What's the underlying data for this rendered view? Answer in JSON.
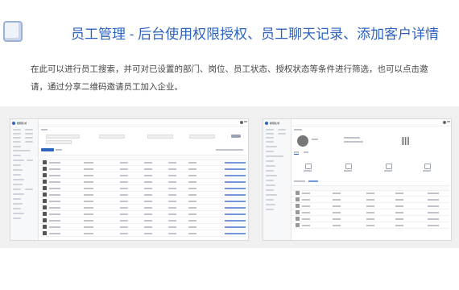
{
  "header": {
    "title": "员工管理 - 后台使用权限授权、员工聊天记录、添加客户详情"
  },
  "description": {
    "text": "在此可以进行员工搜索，并可对已设置的部门、岗位、员工状态、授权状态等条件进行筛选，也可以点击邀请，通过分享二维码邀请员工加入企业。"
  },
  "screenshots": {
    "left": {
      "brand": "瞻眼私域"
    },
    "right": {
      "brand": "瞻眼私域"
    }
  },
  "colors": {
    "accent": "#2f63c0",
    "text": "#444444",
    "band": "#f0f0f0"
  }
}
